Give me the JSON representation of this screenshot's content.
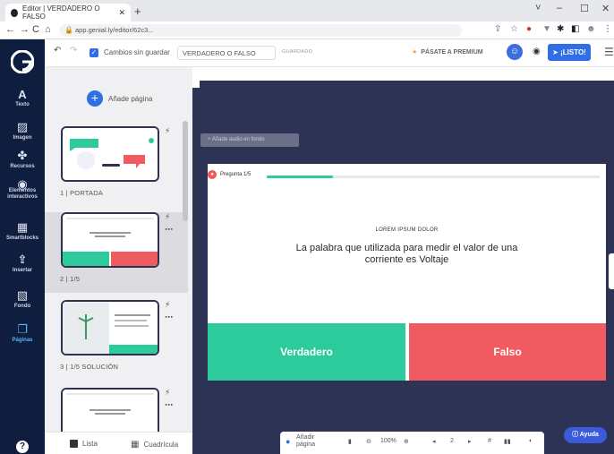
{
  "browser": {
    "tab_title": "Editor | VERDADERO O FALSO",
    "url": "app.genial.ly/editor/62c3...",
    "window_controls": [
      "˅",
      "–",
      "☐",
      "✕"
    ]
  },
  "sidebar": {
    "items": [
      {
        "label": "Texto",
        "icon": "A"
      },
      {
        "label": "Imagen",
        "icon": "▨"
      },
      {
        "label": "Recursos",
        "icon": "✤"
      },
      {
        "label": "Elementos interactivos",
        "icon": "◉"
      },
      {
        "label": "Smartblocks",
        "icon": "▦"
      },
      {
        "label": "Insertar",
        "icon": "⇪"
      },
      {
        "label": "Fondo",
        "icon": "▧"
      },
      {
        "label": "Páginas",
        "icon": "❐"
      }
    ],
    "help": "?"
  },
  "toolbar": {
    "unsaved": "Cambios sin guardar",
    "title_value": "VERDADERO O FALSO",
    "saved": "GUARDADO",
    "premium": "PÁSATE A PREMIUM",
    "ready": "¡LISTO!"
  },
  "pages_panel": {
    "add_page": "Añade página",
    "pages": [
      {
        "label": "1 | PORTADA"
      },
      {
        "label": "2 | 1/5"
      },
      {
        "label": "3 | 1/5 SOLUCIÓN"
      }
    ],
    "footer": {
      "list": "Lista",
      "grid": "Cuadrícula"
    }
  },
  "canvas": {
    "audio_button": "Añade audio en fondo",
    "progress_label": "Pregunta 1/5",
    "progress_value": 0.2,
    "kicker": "LOREM IPSUM DOLOR",
    "question": "La palabra que utilizada para medir el valor de una corriente es Voltaje",
    "true_label": "Verdadero",
    "false_label": "Falso"
  },
  "bottombar": {
    "add_page": "Añadir página",
    "zoom": "100%",
    "page_number": "2"
  },
  "help_button": "Ayuda",
  "colors": {
    "sidebar": "#0f1d3e",
    "canvas": "#2c3355",
    "accent": "#2f6ee5",
    "green": "#2dcb9b",
    "red": "#f05b61"
  }
}
